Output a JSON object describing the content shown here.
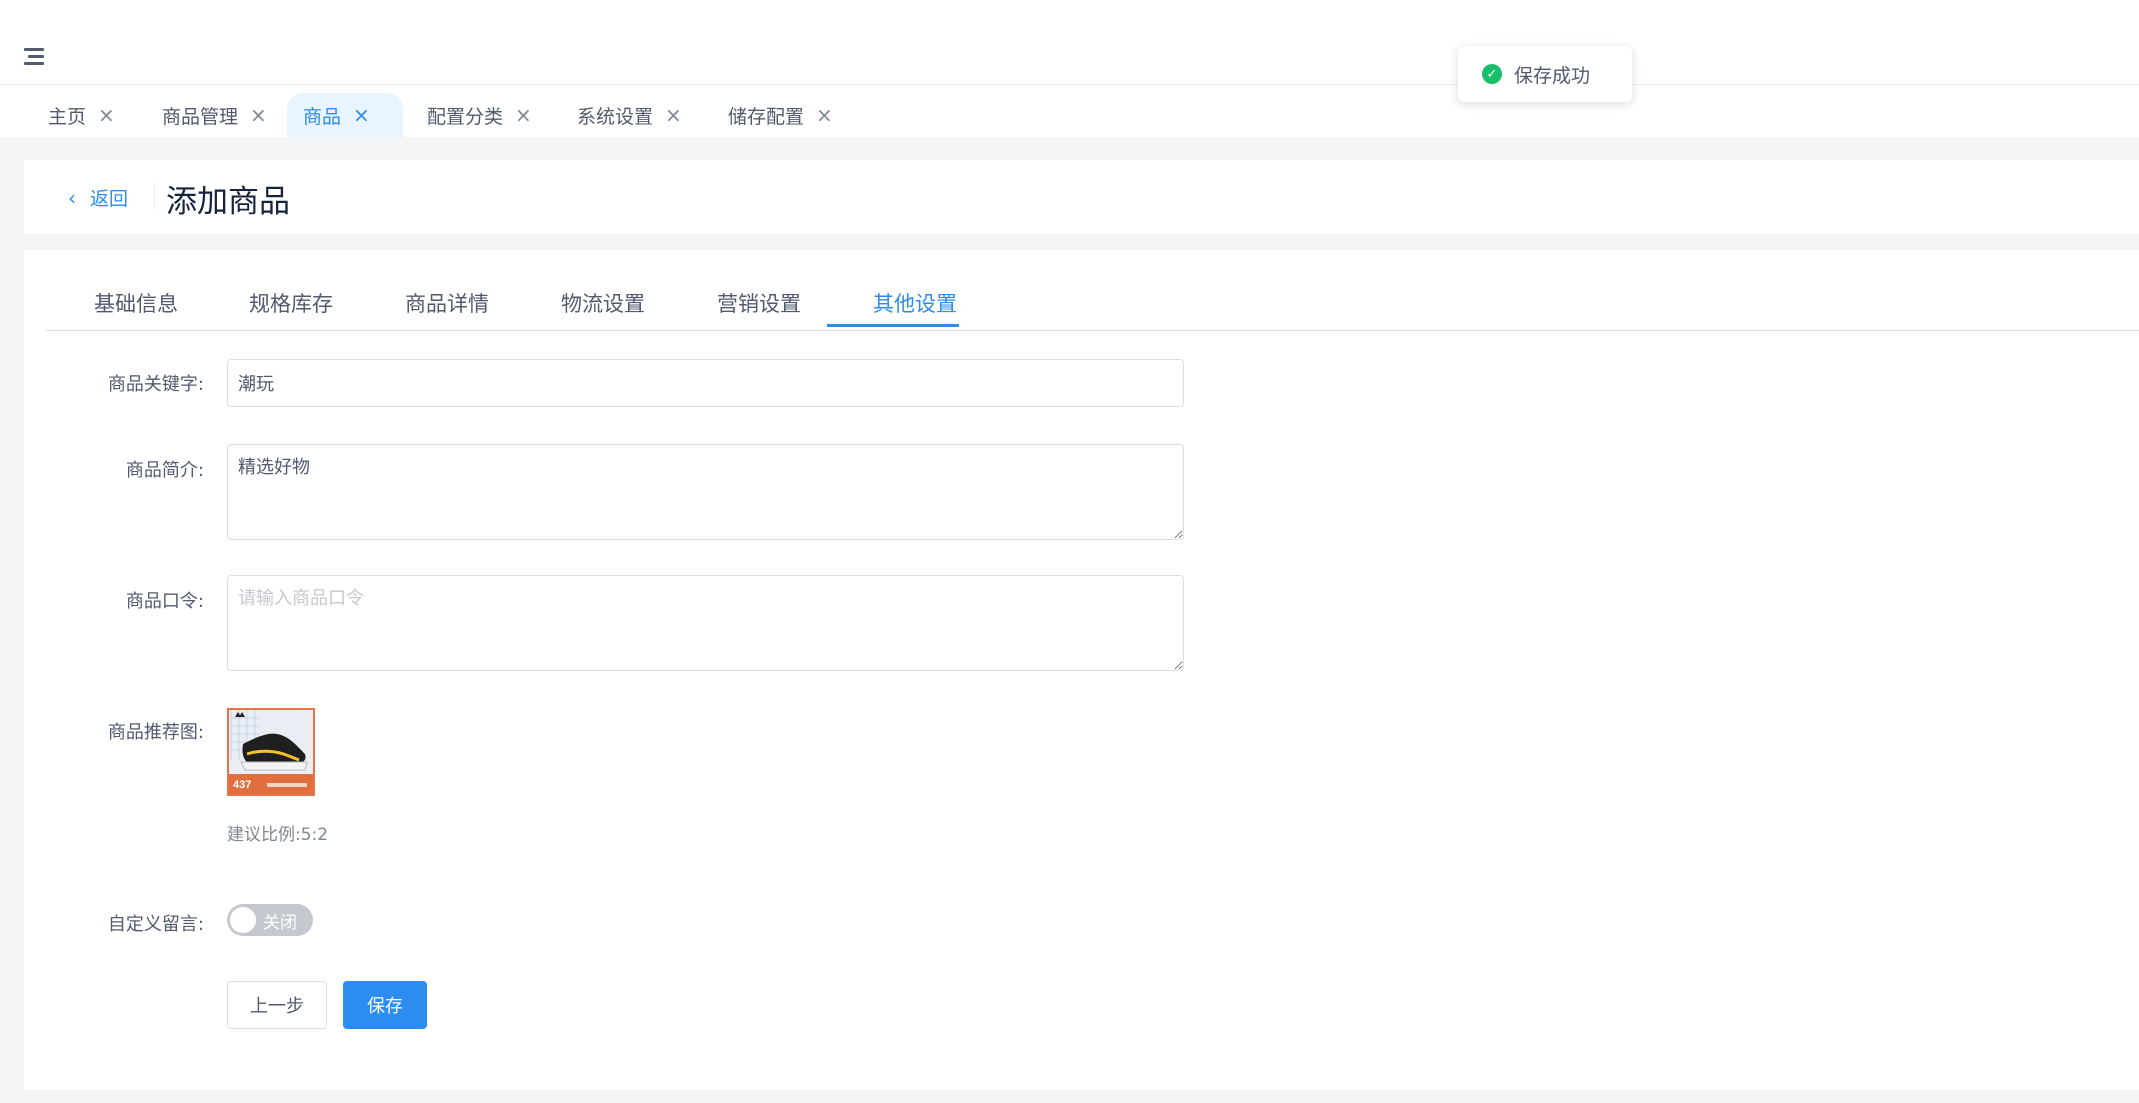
{
  "header": {
    "menu_icon": "menu-fold-icon"
  },
  "tabs": [
    {
      "label": "主页",
      "close": "×",
      "active": false
    },
    {
      "label": "商品管理",
      "close": "×",
      "active": false
    },
    {
      "label": "商品",
      "close": "×",
      "active": true
    },
    {
      "label": "配置分类",
      "close": "×",
      "active": false
    },
    {
      "label": "系统设置",
      "close": "×",
      "active": false
    },
    {
      "label": "储存配置",
      "close": "×",
      "active": false
    }
  ],
  "page": {
    "back_icon": "‹",
    "back_label": "返回",
    "title": "添加商品"
  },
  "subtabs": [
    {
      "label": "基础信息",
      "active": false
    },
    {
      "label": "规格库存",
      "active": false
    },
    {
      "label": "商品详情",
      "active": false
    },
    {
      "label": "物流设置",
      "active": false
    },
    {
      "label": "营销设置",
      "active": false
    },
    {
      "label": "其他设置",
      "active": true
    }
  ],
  "form": {
    "keyword": {
      "label": "商品关键字:",
      "value": "潮玩"
    },
    "intro": {
      "label": "商品简介:",
      "value": "精选好物"
    },
    "command": {
      "label": "商品口令:",
      "value": "",
      "placeholder": "请输入商品口令"
    },
    "image": {
      "label": "商品推荐图:",
      "hint": "建议比例:5:2",
      "price_tag": "437",
      "brand_mark": "adidas"
    },
    "message": {
      "label": "自定义留言:",
      "switch_text": "关闭",
      "on": false
    }
  },
  "buttons": {
    "prev": "上一步",
    "save": "保存"
  },
  "toast": {
    "icon": "check-circle-icon",
    "text": "保存成功",
    "color": "#19be6b"
  },
  "colors": {
    "primary": "#2d8cf0",
    "success": "#19be6b"
  }
}
